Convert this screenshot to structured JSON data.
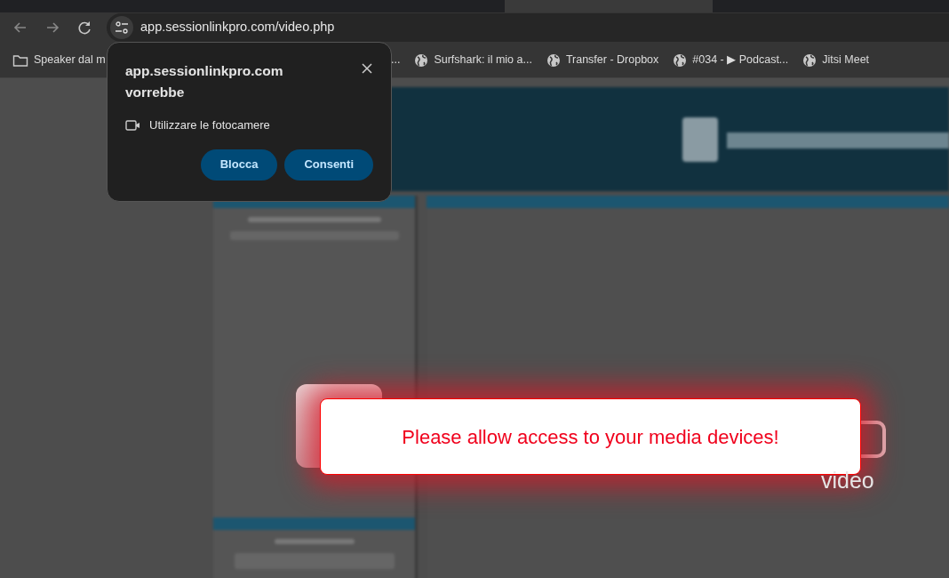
{
  "browser": {
    "address": "app.sessionlinkpro.com/video.php",
    "bookmarks": [
      {
        "kind": "folder",
        "label": "Speaker dal m"
      },
      {
        "kind": "fragment",
        "label": "..."
      },
      {
        "kind": "site",
        "label": "Surfshark: il mio a..."
      },
      {
        "kind": "site",
        "label": "Transfer - Dropbox"
      },
      {
        "kind": "site",
        "label": "#034 - ▶ Podcast..."
      },
      {
        "kind": "site",
        "label": "Jitsi Meet"
      }
    ]
  },
  "permission_popup": {
    "title": "app.sessionlinkpro.com vorrebbe",
    "permission": "Utilizzare le fotocamere",
    "buttons": [
      "Blocca",
      "Consenti"
    ]
  },
  "page": {
    "logo_caption": "video",
    "alert": "Please allow access to your media devices!"
  }
}
